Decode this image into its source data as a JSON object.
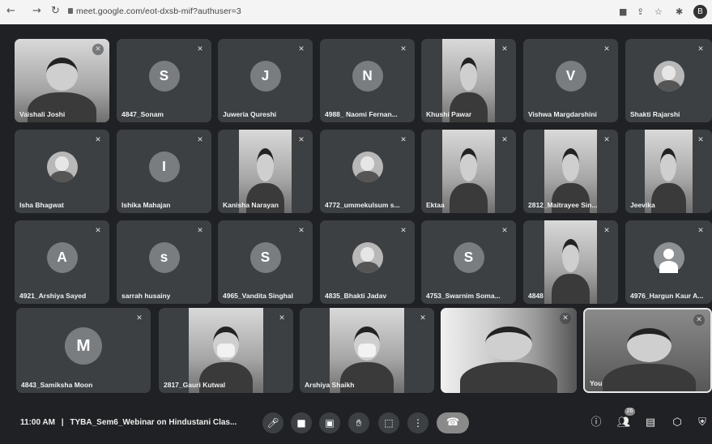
{
  "browser": {
    "url": "meet.google.com/eot-dxsb-mif?authuser=3",
    "profile_initial": "B"
  },
  "participants": [
    {
      "name": "Vaishali Joshi",
      "kind": "video"
    },
    {
      "name": "4847_Sonam",
      "kind": "letter",
      "initial": "S"
    },
    {
      "name": "Juweria Qureshi",
      "kind": "letter",
      "initial": "J"
    },
    {
      "name": "4988_ Naomi Fernan...",
      "kind": "letter",
      "initial": "N"
    },
    {
      "name": "Khushi Pawar",
      "kind": "video"
    },
    {
      "name": "Vishwa Margdarshini",
      "kind": "letter",
      "initial": "V"
    },
    {
      "name": "Shakti Rajarshi",
      "kind": "photo"
    },
    {
      "name": "Isha Bhagwat",
      "kind": "photo"
    },
    {
      "name": "Ishika Mahajan",
      "kind": "letter",
      "initial": "I"
    },
    {
      "name": "Kanisha Narayan",
      "kind": "video"
    },
    {
      "name": "4772_ummekulsum s...",
      "kind": "photo"
    },
    {
      "name": "Ektaa",
      "kind": "video"
    },
    {
      "name": "2812_Maitrayee Sin...",
      "kind": "video"
    },
    {
      "name": "Jeevika",
      "kind": "video"
    },
    {
      "name": "4921_Arshiya Sayed",
      "kind": "letter",
      "initial": "A"
    },
    {
      "name": "sarrah husainy",
      "kind": "letter",
      "initial": "s"
    },
    {
      "name": "4965_Vandita Singhal",
      "kind": "letter",
      "initial": "S"
    },
    {
      "name": "4835_Bhakti Jadav",
      "kind": "photo"
    },
    {
      "name": "4753_Swarnim Soma...",
      "kind": "letter",
      "initial": "S"
    },
    {
      "name": "4848",
      "kind": "video"
    },
    {
      "name": "4976_Hargun Kaur A...",
      "kind": "generic"
    },
    {
      "name": "4843_Samiksha Moon",
      "kind": "letter",
      "initial": "M"
    },
    {
      "name": "2817_Gauri Kutwal",
      "kind": "video-mask"
    },
    {
      "name": "Arshiya Shaikh",
      "kind": "video-mask"
    },
    {
      "name": "",
      "kind": "video-wide"
    },
    {
      "name": "You",
      "kind": "video-dark"
    }
  ],
  "bottom_bar": {
    "time": "11:00 AM",
    "separator": "|",
    "meeting_title": "TYBA_Sem6_Webinar on Hindustani Clas...",
    "participant_count": "26",
    "icons": {
      "mic": "mic-icon",
      "camera": "camera-icon",
      "captions": "captions-icon",
      "raise_hand": "raise-hand-icon",
      "present": "present-icon",
      "more": "more-options-icon",
      "end_call": "end-call-icon",
      "info": "info-icon",
      "people": "people-icon",
      "chat": "chat-icon",
      "activities": "activities-icon",
      "host": "host-controls-icon"
    }
  },
  "colors": {
    "tile": "#3c4043",
    "background": "#202124",
    "text": "#f1f1f1"
  }
}
